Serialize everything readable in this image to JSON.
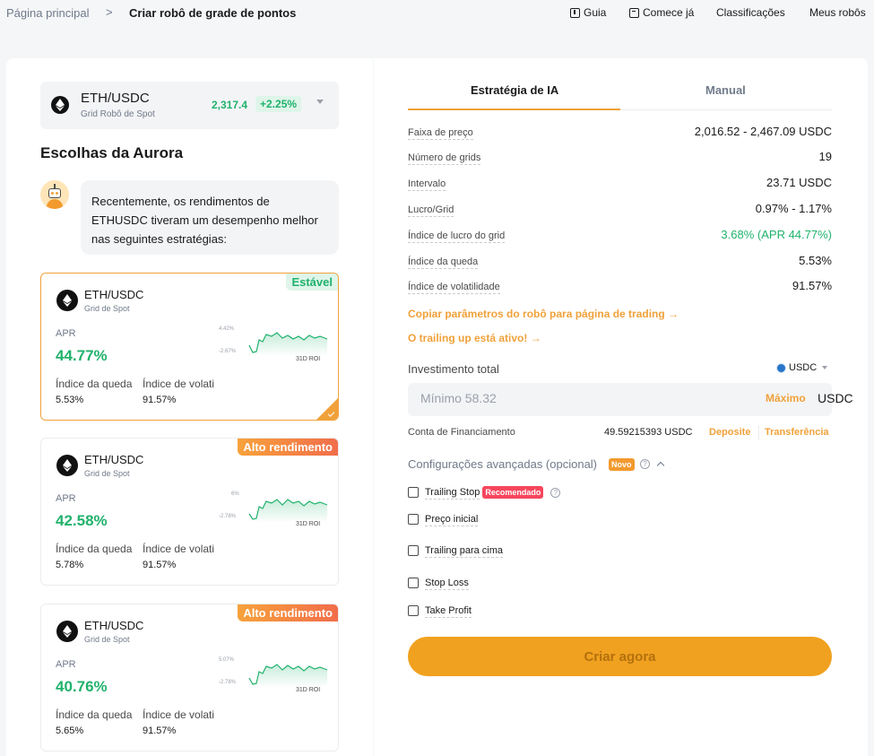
{
  "breadcrumb": {
    "home": "Página principal",
    "separator": ">",
    "current": "Criar robô de grade de pontos"
  },
  "nav": {
    "guide": "Guia",
    "start": "Comece já",
    "rankings": "Classificações",
    "my_bots": "Meus robôs"
  },
  "pair_selector": {
    "name": "ETH/USDC",
    "subtitle": "Grid Robô de Spot",
    "price": "2,317.4",
    "change": "+2.25%"
  },
  "aurora": {
    "title": "Escolhas da Aurora",
    "message": "Recentemente, os rendimentos de ETHUSDC tiveram um desempenho melhor nas seguintes estratégias:"
  },
  "cards": [
    {
      "name": "ETH/USDC",
      "subtitle": "Grid de Spot",
      "badge": "Estável",
      "apr_label": "APR",
      "apr": "44.77%",
      "m1_label": "Índice da queda",
      "m1": "5.53%",
      "m2_label": "Índice de volatilidade",
      "m2": "91.57%",
      "spark_top": "4.42%",
      "spark_bot": "-2.67%",
      "roi_label": "31D ROI"
    },
    {
      "name": "ETH/USDC",
      "subtitle": "Grid de Spot",
      "badge": "Alto rendimento",
      "apr_label": "APR",
      "apr": "42.58%",
      "m1_label": "Índice da queda",
      "m1": "5.78%",
      "m2_label": "Índice de volatilidade",
      "m2": "91.57%",
      "spark_top": "6%",
      "spark_bot": "-2.78%",
      "roi_label": "31D ROI"
    },
    {
      "name": "ETH/USDC",
      "subtitle": "Grid de Spot",
      "badge": "Alto rendimento",
      "apr_label": "APR",
      "apr": "40.76%",
      "m1_label": "Índice da queda",
      "m1": "5.65%",
      "m2_label": "Índice de volatilidade",
      "m2": "91.57%",
      "spark_top": "5.07%",
      "spark_bot": "-2.78%",
      "roi_label": "31D ROI"
    }
  ],
  "tabs": {
    "ai": "Estratégia de IA",
    "manual": "Manual"
  },
  "params": [
    {
      "label": "Faixa de preço",
      "value": "2,016.52 - 2,467.09 USDC"
    },
    {
      "label": "Número de grids",
      "value": "19"
    },
    {
      "label": "Intervalo",
      "value": "23.71 USDC"
    },
    {
      "label": "Lucro/Grid",
      "value": "0.97% - 1.17%"
    },
    {
      "label": "Índice de lucro do grid",
      "value": "3.68% (APR 44.77%)"
    },
    {
      "label": "Índice da queda",
      "value": "5.53%"
    },
    {
      "label": "Índice de volatilidade",
      "value": "91.57%"
    }
  ],
  "links": {
    "copy_params": "Copiar parâmetros do robô para página de trading →",
    "trailing_active": "O trailing up está ativo! →"
  },
  "investment": {
    "label": "Investimento total",
    "currency": "USDC",
    "placeholder": "Mínimo 58.32",
    "max_label": "Máximo",
    "unit": "USDC",
    "funding_label": "Conta de Financiamento",
    "funding_value": "49.59215393 USDC",
    "deposit": "Deposite",
    "transfer": "Transferência"
  },
  "advanced": {
    "label": "Configurações avançadas (opcional)",
    "new_badge": "Novo",
    "options": [
      {
        "label": "Trailing Stop",
        "badge": "Recomendado"
      },
      {
        "label": "Preço inicial"
      },
      {
        "label": "Trailing para cima"
      },
      {
        "label": "Stop Loss"
      },
      {
        "label": "Take Profit"
      }
    ]
  },
  "create_button": "Criar agora",
  "colors": {
    "accent": "#f0a13a",
    "positive": "#20b26c",
    "badge_red": "#f6465d"
  }
}
